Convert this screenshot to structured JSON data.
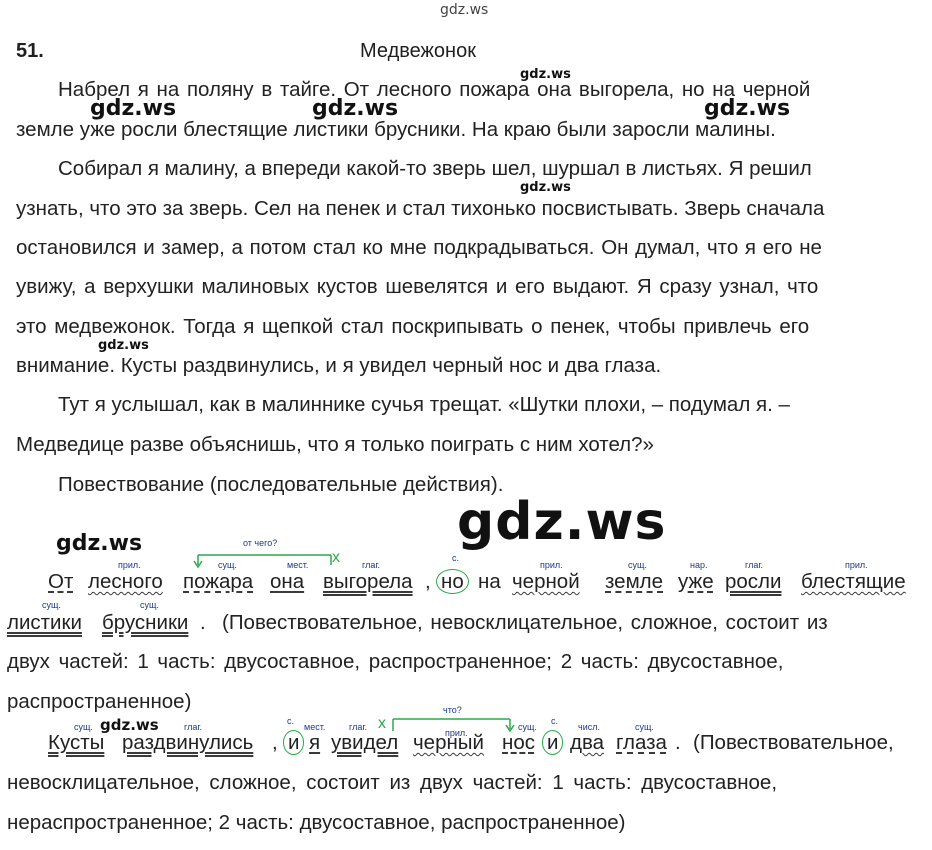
{
  "watermark": "gdz.ws",
  "exercise": {
    "number": "51.",
    "title": "Медвежонок"
  },
  "text_lines": [
    "Набрел я на поляну в тайге. От лесного пожара она выгорела, но на черной",
    "земле уже росли блестящие листики брусники. На краю были заросли малины.",
    "Собирал я малину, а впереди какой-то зверь шел, шуршал в листьях. Я решил",
    "узнать, что это за зверь. Сел на пенек и стал тихонько посвистывать. Зверь сначала",
    "остановился и замер, а потом стал ко мне подкрадываться. Он думал, что я его не",
    "увижу, а верхушки малиновых кустов шевелятся и его выдают. Я сразу узнал, что",
    "это медвежонок. Тогда я щепкой стал поскрипывать о пенек, чтобы привлечь его",
    "внимание. Кусты раздвинулись, и я увидел черный нос и два глаза.",
    "Тут я услышал, как в малиннике сучья трещат. «Шутки плохи, – подумал я. –",
    "Медведице разве объяснишь, что я только поиграть с ним хотел?»",
    "Повествование (последовательные действия)."
  ],
  "analysis1": {
    "question": "от чего?",
    "cross": "x",
    "words": [
      "От",
      "лесного",
      "пожара",
      "она",
      "выгорела",
      ",",
      "но",
      "на",
      "черной",
      "земле",
      "уже",
      "росли",
      "блестящие"
    ],
    "labels": [
      "прил.",
      "сущ.",
      "мест.",
      "глаг.",
      "с.",
      "прил.",
      "сущ.",
      "нар.",
      "глаг.",
      "прил."
    ],
    "line2_labels": [
      "сущ.",
      "сущ."
    ],
    "line2_words": [
      "листики",
      "брусники",
      "."
    ],
    "line2_rest": "(Повествовательное, невосклицательное, сложное, состоит из",
    "line3": "двух частей: 1 часть: двусоставное, распространенное; 2 часть: двусоставное,",
    "line4": "распространенное)"
  },
  "analysis2": {
    "question": "что?",
    "cross": "x",
    "labels": [
      "сущ.",
      "глаг.",
      "с.",
      "мест.",
      "глаг.",
      "прил.",
      "сущ.",
      "с.",
      "числ.",
      "сущ."
    ],
    "words": [
      "Кусты",
      "раздвинулись",
      ",",
      "и",
      "я",
      "увидел",
      "черный",
      "нос",
      "и",
      "два",
      "глаза",
      "."
    ],
    "rest": "(Повествовательное,",
    "line2": "невосклицательное, сложное, состоит из двух частей: 1 часть: двусоставное,",
    "line3": "нераспространенное; 2 часть: двусоставное, распространенное)"
  }
}
